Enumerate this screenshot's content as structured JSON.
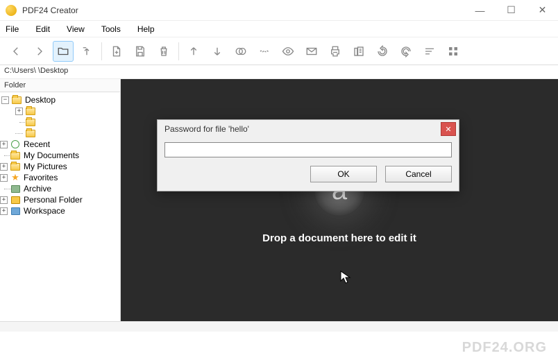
{
  "titlebar": {
    "title": "PDF24 Creator"
  },
  "menubar": [
    "File",
    "Edit",
    "View",
    "Tools",
    "Help"
  ],
  "path": "C:\\Users\\     \\Desktop",
  "sidebar": {
    "header": "Folder",
    "nodes": [
      {
        "label": "Desktop",
        "icon": "folder",
        "expand": "minus",
        "depth": 0
      },
      {
        "label": "",
        "icon": "folder",
        "expand": "plus",
        "depth": 2
      },
      {
        "label": "",
        "icon": "folder",
        "expand": "none",
        "depth": 2
      },
      {
        "label": "",
        "icon": "folder",
        "expand": "none",
        "depth": 2
      },
      {
        "label": "Recent",
        "icon": "clock",
        "expand": "plus",
        "depth": 1
      },
      {
        "label": "My Documents",
        "icon": "doc",
        "expand": "none",
        "depth": 1
      },
      {
        "label": "My Pictures",
        "icon": "pic",
        "expand": "plus",
        "depth": 1
      },
      {
        "label": "Favorites",
        "icon": "star",
        "expand": "plus",
        "depth": 1
      },
      {
        "label": "Archive",
        "icon": "gfold",
        "expand": "none",
        "depth": 1
      },
      {
        "label": "Personal Folder",
        "icon": "pfold",
        "expand": "plus",
        "depth": 1
      },
      {
        "label": "Workspace",
        "icon": "ws",
        "expand": "plus",
        "depth": 1
      }
    ]
  },
  "main": {
    "drop_text": "Drop a document here to edit it",
    "glyph": "a"
  },
  "dialog": {
    "title": "Password for file 'hello'",
    "ok": "OK",
    "cancel": "Cancel",
    "value": ""
  },
  "footer": "PDF24.ORG"
}
